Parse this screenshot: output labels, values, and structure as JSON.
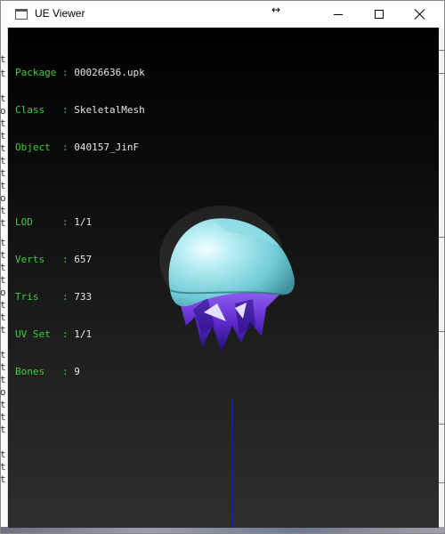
{
  "window": {
    "title": "UE Viewer",
    "minimize_icon": "minimize-icon",
    "maximize_icon": "maximize-icon",
    "close_icon": "close-icon"
  },
  "info": [
    {
      "key": "Package",
      "sep": " : ",
      "value": "00026636.upk"
    },
    {
      "key": "Class  ",
      "sep": " : ",
      "value": "SkeletalMesh"
    },
    {
      "key": "Object ",
      "sep": " : ",
      "value": "040157_JinF"
    }
  ],
  "stats": [
    {
      "key": "LOD    ",
      "sep": " : ",
      "value": "1/1"
    },
    {
      "key": "Verts  ",
      "sep": " : ",
      "value": "657"
    },
    {
      "key": "Tris   ",
      "sep": " : ",
      "value": "733"
    },
    {
      "key": "UV Set ",
      "sep": " : ",
      "value": "1/1"
    },
    {
      "key": "Bones  ",
      "sep": " : ",
      "value": "9"
    }
  ],
  "background_left_glyph": "t",
  "colors": {
    "label": "#3ccd3c",
    "value": "#e6e6e6",
    "hat": "#7fd6df",
    "hair": "#6a2fd0",
    "axis": "#1a1aa8"
  }
}
